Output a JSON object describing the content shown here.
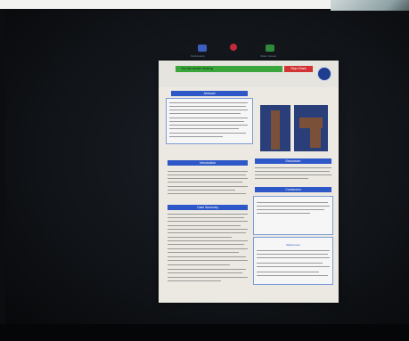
{
  "meeting": {
    "toolbar_labels": [
      "Participants",
      "Share Screen"
    ],
    "share_notice": "You are screen sharing",
    "stop_label": "Stop Share"
  },
  "poster": {
    "title_lines": [
      "",
      ""
    ],
    "sections": {
      "abstract": "Abstract",
      "introduction": "Introduction",
      "case_summary": "Case Summary",
      "discussion": "Discussion",
      "conclusion": "Conclusion",
      "references": "References"
    },
    "figure_captions": [
      "",
      ""
    ]
  },
  "colors": {
    "section_blue": "#2e57c8",
    "share_green": "#3aa53a",
    "stop_red": "#d23333"
  }
}
